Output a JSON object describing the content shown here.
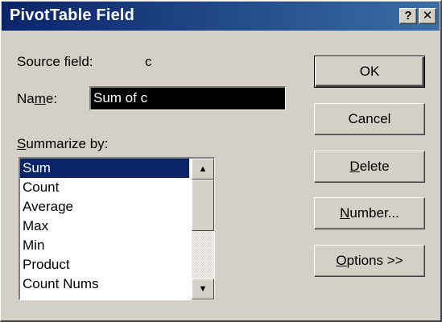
{
  "dialog": {
    "title": "PivotTable Field",
    "help_button": "?",
    "close_button": "✕"
  },
  "source_field": {
    "label": "Source field:",
    "value": "c"
  },
  "name": {
    "label_pre": "Na",
    "label_accel": "m",
    "label_post": "e:",
    "value": "Sum of c"
  },
  "summarize": {
    "label_accel": "S",
    "label_post": "ummarize by:",
    "items": [
      "Sum",
      "Count",
      "Average",
      "Max",
      "Min",
      "Product",
      "Count Nums"
    ],
    "selected": "Sum"
  },
  "scrollbar": {
    "up_arrow": "▲",
    "down_arrow": "▼"
  },
  "buttons": {
    "ok": "OK",
    "cancel": "Cancel",
    "delete_accel": "D",
    "delete_post": "elete",
    "number_accel": "N",
    "number_post": "umber...",
    "options_accel": "O",
    "options_post": "ptions >>"
  }
}
